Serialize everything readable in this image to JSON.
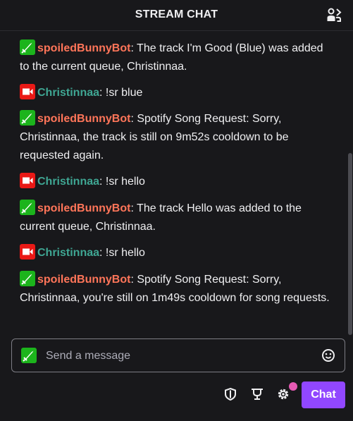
{
  "header": {
    "title": "STREAM CHAT",
    "users_icon": "community-icon"
  },
  "colors": {
    "bot_name": "#ff7559",
    "user_name": "#3fa693",
    "accent": "#9147ff",
    "bot_badge": "#1cb41c",
    "broadcaster_badge": "#e91916"
  },
  "messages": [
    {
      "badge": "bot",
      "user": "spoiledBunnyBot",
      "separator": ":",
      "text": " The track I'm Good (Blue) was added to the current queue, Christinnaa."
    },
    {
      "badge": "broadcaster",
      "user": "Christinnaa",
      "separator": ":",
      "text": " !sr blue"
    },
    {
      "badge": "bot",
      "user": "spoiledBunnyBot",
      "separator": ":",
      "text": " Spotify Song Request: Sorry, Christinnaa, the track is still on 9m52s cooldown to be requested again."
    },
    {
      "badge": "broadcaster",
      "user": "Christinnaa",
      "separator": ":",
      "text": " !sr hello"
    },
    {
      "badge": "bot",
      "user": "spoiledBunnyBot",
      "separator": ":",
      "text": " The track Hello was added to the current queue, Christinnaa."
    },
    {
      "badge": "broadcaster",
      "user": "Christinnaa",
      "separator": ":",
      "text": " !sr hello"
    },
    {
      "badge": "bot",
      "user": "spoiledBunnyBot",
      "separator": ":",
      "text": " Spotify Song Request: Sorry, Christinnaa, you're still on 1m49s cooldown for song requests."
    }
  ],
  "composer": {
    "placeholder": "Send a message",
    "badge": "bot",
    "emote_icon": "smiley-icon"
  },
  "toolbar": {
    "icons": [
      "shield-icon",
      "trophy-icon",
      "gear-icon"
    ],
    "chat_button": "Chat"
  }
}
